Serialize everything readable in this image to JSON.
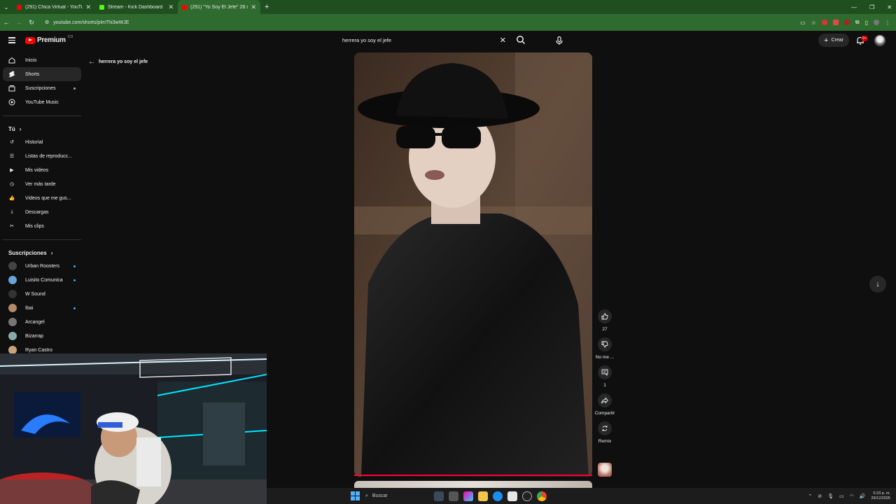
{
  "browser": {
    "tabs": [
      {
        "title": "(291) Chica Virtual - YouTube",
        "color": "#ff0000"
      },
      {
        "title": "Stream - Kick Dashboard",
        "color": "#53fc18"
      },
      {
        "title": "(291) \"Yo Soy El Jefe\" 28 de di...",
        "color": "#ff0000",
        "active": true
      }
    ],
    "url": "youtube.com/shorts/pImThi3wWJE"
  },
  "header": {
    "logo": "Premium",
    "logo_region": "CO",
    "search_query": "herrera yo soy el jefe",
    "create_label": "Crear",
    "notif_count": "9+"
  },
  "sidebar": {
    "main": [
      {
        "label": "Inicio",
        "icon": "home-icon"
      },
      {
        "label": "Shorts",
        "icon": "shorts-icon",
        "selected": true
      },
      {
        "label": "Suscripciones",
        "icon": "subscriptions-icon",
        "dot": true
      },
      {
        "label": "YouTube Music",
        "icon": "music-icon"
      }
    ],
    "you_heading": "Tú",
    "you": [
      {
        "label": "Historial",
        "icon": "history-icon"
      },
      {
        "label": "Listas de reproducc...",
        "icon": "playlist-icon"
      },
      {
        "label": "Mis videos",
        "icon": "my-videos-icon"
      },
      {
        "label": "Ver más tarde",
        "icon": "watch-later-icon"
      },
      {
        "label": "Videos que me gus...",
        "icon": "liked-icon"
      },
      {
        "label": "Descargas",
        "icon": "download-icon"
      },
      {
        "label": "Mis clips",
        "icon": "clips-icon"
      }
    ],
    "subs_heading": "Suscripciones",
    "subs": [
      {
        "label": "Urban Roosters",
        "color": "#444",
        "dot": true
      },
      {
        "label": "Luisito Comunica",
        "color": "#6aa3d8",
        "dot": true
      },
      {
        "label": "W Sound",
        "color": "#333"
      },
      {
        "label": "Ibai",
        "color": "#b58a6a",
        "dot": true
      },
      {
        "label": "Arcangel",
        "color": "#777"
      },
      {
        "label": "Bizarrap",
        "color": "#8aa"
      },
      {
        "label": "Ryan Castro",
        "color": "#c9a27c"
      }
    ]
  },
  "back_label": "herrera yo soy el jefe",
  "actions": {
    "likes": "27",
    "dislike_label": "No me ...",
    "comments": "1",
    "share_label": "Compartir",
    "remix_label": "Remix"
  },
  "taskbar": {
    "search_label": "Buscar",
    "time": "5:23 p. m.",
    "date": "29/12/2025"
  }
}
